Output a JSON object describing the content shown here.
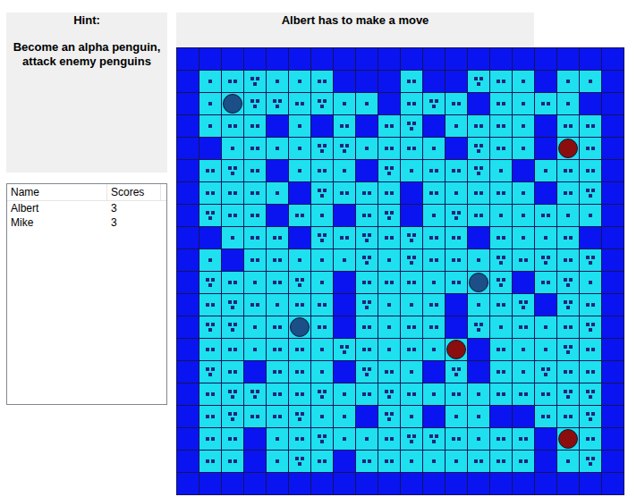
{
  "hint": {
    "title": "Hint:",
    "text": "Become an alpha penguin, attack enemy penguins"
  },
  "status": "Albert has to make a move",
  "scores": {
    "columns": [
      "Name",
      "Scores"
    ],
    "rows": [
      {
        "name": "Albert",
        "score": "3"
      },
      {
        "name": "Mike",
        "score": "3"
      }
    ]
  },
  "board": {
    "rows": [
      "00000000000000000000",
      "01231120002003210110",
      "01133231102320212100",
      "01220102023012210220",
      "00121133122103210120",
      "02320121031223101220",
      "02221032220212210230",
      "03220210230132112110",
      "00122032323220211200",
      "01022111313221323230",
      "03212310222122302310",
      "02321220311201230320",
      "03312120212203121230",
      "02212213212110211320",
      "03202210321030213220",
      "02332231232121222330",
      "02322311031011002230",
      "02201231123321220120",
      "02201320221112220130",
      "00000000000000000000"
    ]
  },
  "penguins": [
    {
      "row": 2,
      "col": 2,
      "color": "#1c4f87"
    },
    {
      "row": 4,
      "col": 17,
      "color": "#8b0d0d"
    },
    {
      "row": 10,
      "col": 13,
      "color": "#1c4f87"
    },
    {
      "row": 12,
      "col": 5,
      "color": "#1c4f87"
    },
    {
      "row": 13,
      "col": 12,
      "color": "#8b0d0d"
    },
    {
      "row": 17,
      "col": 17,
      "color": "#8b0d0d"
    }
  ]
}
